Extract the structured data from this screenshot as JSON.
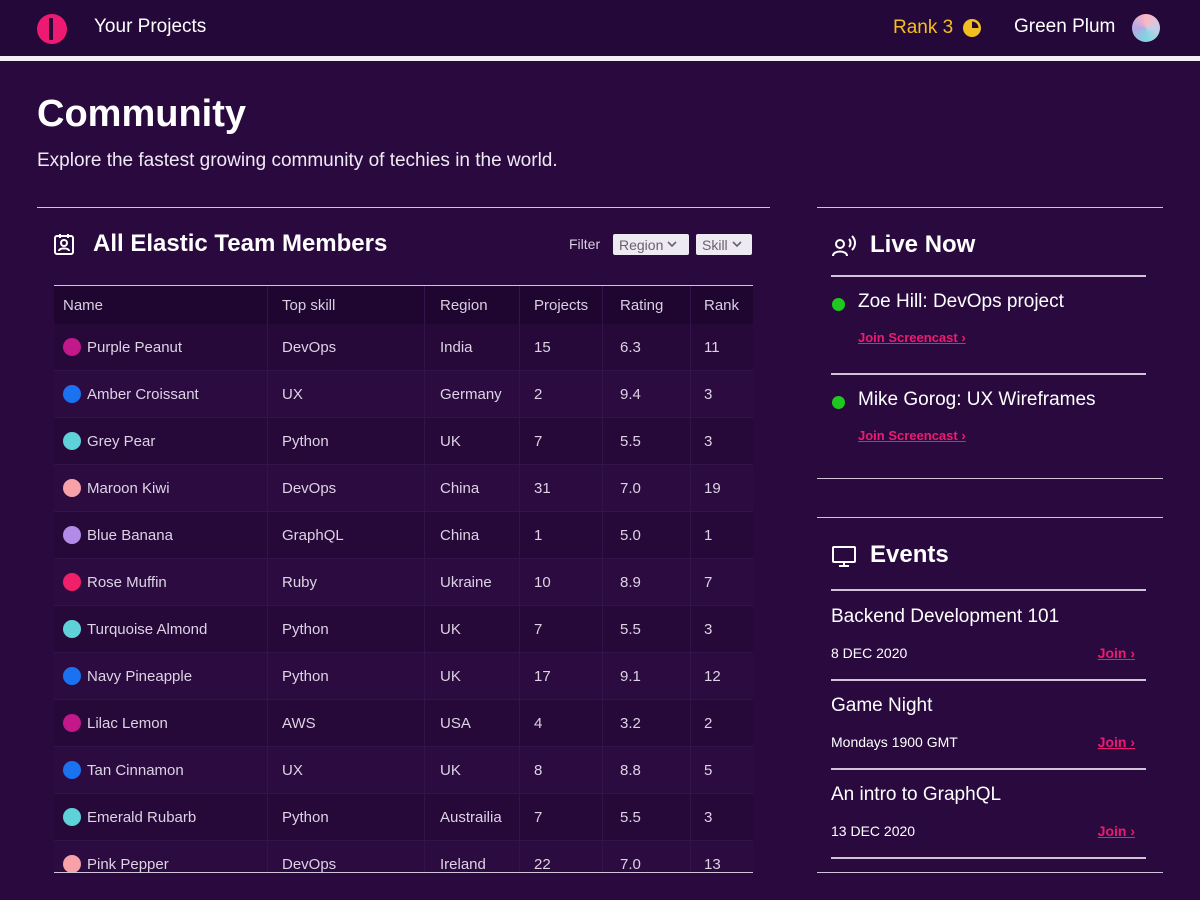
{
  "nav": {
    "title": "Your Projects",
    "rank_label": "Rank 3",
    "username": "Green Plum",
    "logo_icon": "logo-icon",
    "rank_icon": "pie-chart-icon"
  },
  "page": {
    "title": "Community",
    "subtitle": "Explore the fastest growing community of techies in the world."
  },
  "members": {
    "title": "All Elastic Team Members",
    "icon": "contact-card-icon",
    "filter_label": "Filter",
    "filter_region": "Region",
    "filter_skill": "Skill",
    "columns": [
      "Name",
      "Top skill",
      "Region",
      "Projects",
      "Rating",
      "Rank"
    ],
    "rows": [
      {
        "name": "Purple Peanut",
        "skill": "DevOps",
        "region": "India",
        "projects": "15",
        "rating": "6.3",
        "rank": "11",
        "color": "#c2188a"
      },
      {
        "name": "Amber Croissant",
        "skill": "UX",
        "region": "Germany",
        "projects": "2",
        "rating": "9.4",
        "rank": "3",
        "color": "#1a72f0"
      },
      {
        "name": "Grey Pear",
        "skill": "Python",
        "region": "UK",
        "projects": "7",
        "rating": "5.5",
        "rank": "3",
        "color": "#5ed2d8"
      },
      {
        "name": "Maroon Kiwi",
        "skill": "DevOps",
        "region": "China",
        "projects": "31",
        "rating": "7.0",
        "rank": "19",
        "color": "#f7a1a8"
      },
      {
        "name": "Blue Banana",
        "skill": "GraphQL",
        "region": "China",
        "projects": "1",
        "rating": "5.0",
        "rank": "1",
        "color": "#b28be8"
      },
      {
        "name": "Rose Muffin",
        "skill": "Ruby",
        "region": "Ukraine",
        "projects": "10",
        "rating": "8.9",
        "rank": "7",
        "color": "#ef1f6a"
      },
      {
        "name": "Turquoise Almond",
        "skill": "Python",
        "region": "UK",
        "projects": "7",
        "rating": "5.5",
        "rank": "3",
        "color": "#5ed2d8"
      },
      {
        "name": "Navy Pineapple",
        "skill": "Python",
        "region": "UK",
        "projects": "17",
        "rating": "9.1",
        "rank": "12",
        "color": "#1a72f0"
      },
      {
        "name": "Lilac Lemon",
        "skill": "AWS",
        "region": "USA",
        "projects": "4",
        "rating": "3.2",
        "rank": "2",
        "color": "#c2188a"
      },
      {
        "name": "Tan Cinnamon",
        "skill": "UX",
        "region": "UK",
        "projects": "8",
        "rating": "8.8",
        "rank": "5",
        "color": "#1a72f0"
      },
      {
        "name": "Emerald Rubarb",
        "skill": "Python",
        "region": "Austrailia",
        "projects": "7",
        "rating": "5.5",
        "rank": "3",
        "color": "#5ed2d8"
      },
      {
        "name": "Pink Pepper",
        "skill": "DevOps",
        "region": "Ireland",
        "projects": "22",
        "rating": "7.0",
        "rank": "13",
        "color": "#f7a1a8"
      }
    ]
  },
  "live": {
    "title": "Live Now",
    "icon": "broadcast-user-icon",
    "items": [
      {
        "name": "Zoe Hill: DevOps project",
        "link": "Join Screencast ›"
      },
      {
        "name": "Mike Gorog: UX Wireframes",
        "link": "Join Screencast ›"
      }
    ]
  },
  "events": {
    "title": "Events",
    "icon": "monitor-icon",
    "items": [
      {
        "name": "Backend Development 101",
        "date": "8 DEC 2020",
        "join": "Join ›"
      },
      {
        "name": "Game Night",
        "date": "Mondays 1900 GMT",
        "join": "Join ›"
      },
      {
        "name": "An intro to GraphQL",
        "date": "13 DEC 2020",
        "join": "Join ›"
      }
    ]
  },
  "colors": {
    "background": "#2a0a3e",
    "accent_pink": "#ee1a72",
    "rank_yellow": "#f4bf1e",
    "live_green": "#1fc81f"
  }
}
